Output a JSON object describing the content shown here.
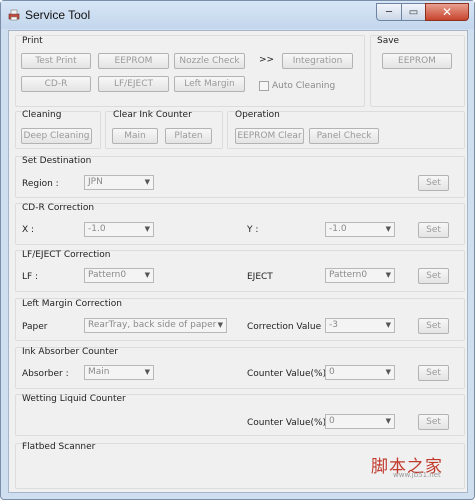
{
  "window": {
    "title": "Service Tool",
    "controls": {
      "minimize": "─",
      "maximize": "▭",
      "close": "✕"
    }
  },
  "print": {
    "title": "Print",
    "buttons": [
      "Test Print",
      "EEPROM",
      "Nozzle Check",
      "Integration",
      "CD-R",
      "LF/EJECT",
      "Left Margin"
    ],
    "arrow": ">>",
    "auto_cleaning": "Auto Cleaning"
  },
  "save": {
    "title": "Save",
    "eeprom": "EEPROM"
  },
  "cleaning": {
    "title": "Cleaning",
    "deep_cleaning": "Deep Cleaning"
  },
  "clear_ink_counter": {
    "title": "Clear Ink Counter",
    "main": "Main",
    "platen": "Platen"
  },
  "operation": {
    "title": "Operation",
    "eeprom_clear": "EEPROM Clear",
    "panel_check": "Panel Check"
  },
  "set_destination": {
    "title": "Set Destination",
    "region_label": "Region :",
    "region_value": "JPN",
    "set": "Set"
  },
  "cdr_correction": {
    "title": "CD-R Correction",
    "x_label": "X :",
    "x_value": "-1.0",
    "y_label": "Y :",
    "y_value": "-1.0",
    "set": "Set"
  },
  "lf_eject_correction": {
    "title": "LF/EJECT Correction",
    "lf_label": "LF :",
    "lf_value": "Pattern0",
    "eject_label": "EJECT",
    "eject_value": "Pattern0",
    "set": "Set"
  },
  "left_margin_correction": {
    "title": "Left Margin Correction",
    "paper_label": "Paper",
    "paper_value": "RearTray, back side of paper",
    "correction_label": "Correction Value",
    "correction_value": "-3",
    "set": "Set"
  },
  "ink_absorber_counter": {
    "title": "Ink Absorber Counter",
    "absorber_label": "Absorber :",
    "absorber_value": "Main",
    "counter_label": "Counter Value(%)",
    "counter_value": "0",
    "set": "Set"
  },
  "wetting_liquid_counter": {
    "title": "Wetting Liquid Counter",
    "counter_label": "Counter Value(%)",
    "counter_value": "0",
    "set": "Set"
  },
  "flatbed_scanner": {
    "title": "Flatbed Scanner"
  },
  "watermark": {
    "text": "脚本之家",
    "url": "www.jb51.net"
  },
  "colors": {
    "title_bar": "#c9dbef",
    "client_bg": "#f0f0f0",
    "close_button": "#c7442d",
    "watermark": "#c0392b"
  }
}
